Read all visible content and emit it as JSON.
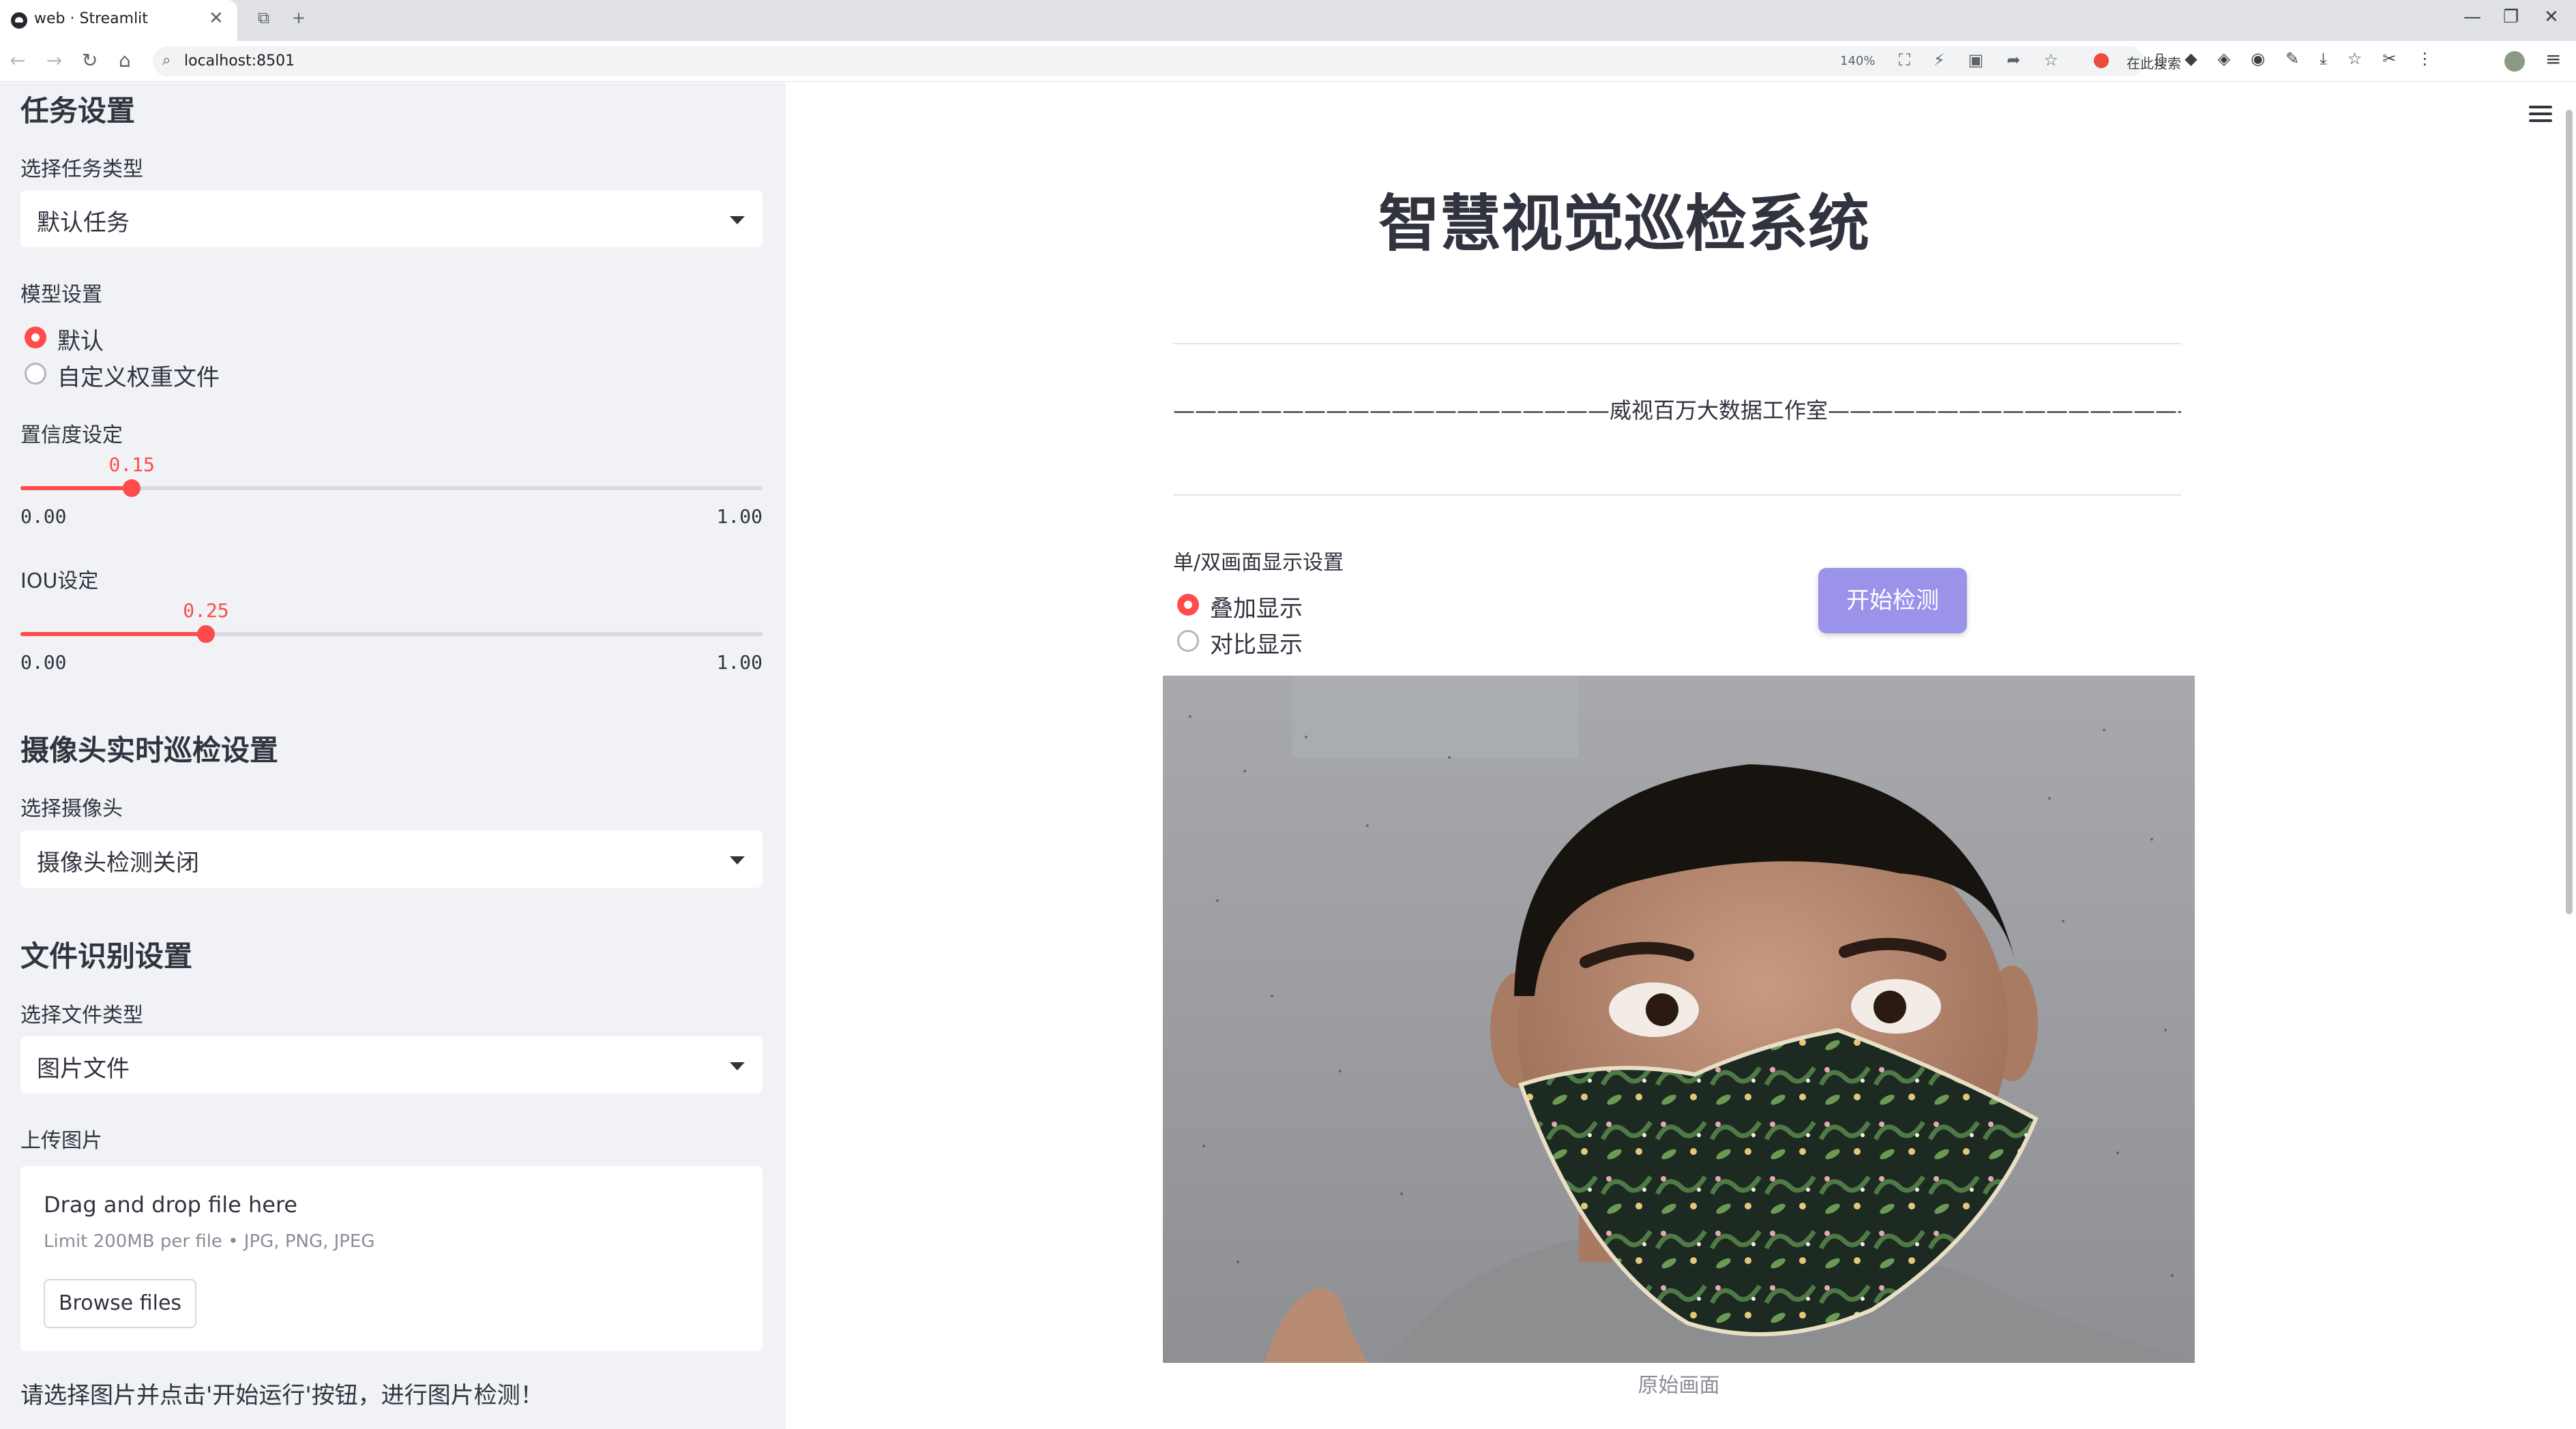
{
  "browser": {
    "tab_title": "web · Streamlit",
    "url": "localhost:8501",
    "zoom": "140%",
    "search_placeholder": "在此搜索",
    "win_minimize": "—",
    "win_restore": "❐",
    "win_close": "✕"
  },
  "sidebar": {
    "task_heading": "任务设置",
    "task_type_label": "选择任务类型",
    "task_type_value": "默认任务",
    "model_label": "模型设置",
    "model_options": [
      "默认",
      "自定义权重文件"
    ],
    "model_selected_index": 0,
    "confidence_label": "置信度设定",
    "confidence": {
      "value": 0.15,
      "value_text": "0.15",
      "min_text": "0.00",
      "max_text": "1.00"
    },
    "iou_label": "IOU设定",
    "iou": {
      "value": 0.25,
      "value_text": "0.25",
      "min_text": "0.00",
      "max_text": "1.00"
    },
    "camera_heading": "摄像头实时巡检设置",
    "camera_label": "选择摄像头",
    "camera_value": "摄像头检测关闭",
    "file_heading": "文件识别设置",
    "file_type_label": "选择文件类型",
    "file_type_value": "图片文件",
    "upload_label": "上传图片",
    "upload_title": "Drag and drop file here",
    "upload_limit": "Limit 200MB per file • JPG, PNG, JPEG",
    "browse_label": "Browse files",
    "hint": "请选择图片并点击'开始运行'按钮，进行图片检测！"
  },
  "main": {
    "title": "智慧视觉巡检系统",
    "banner": "————————————————————威视百万大数据工作室—————————————————————",
    "display_label": "单/双画面显示设置",
    "display_options": [
      "叠加显示",
      "对比显示"
    ],
    "display_selected_index": 0,
    "start_button": "开始检测",
    "image_caption": "原始画面"
  },
  "colors": {
    "accent": "#ff4b4b",
    "button": "#9b93ea",
    "sidebar_bg": "#f0f2f6"
  },
  "icons": [
    "back-icon",
    "forward-icon",
    "reload-icon",
    "home-icon",
    "menu-icon",
    "dropdown-caret-icon"
  ]
}
